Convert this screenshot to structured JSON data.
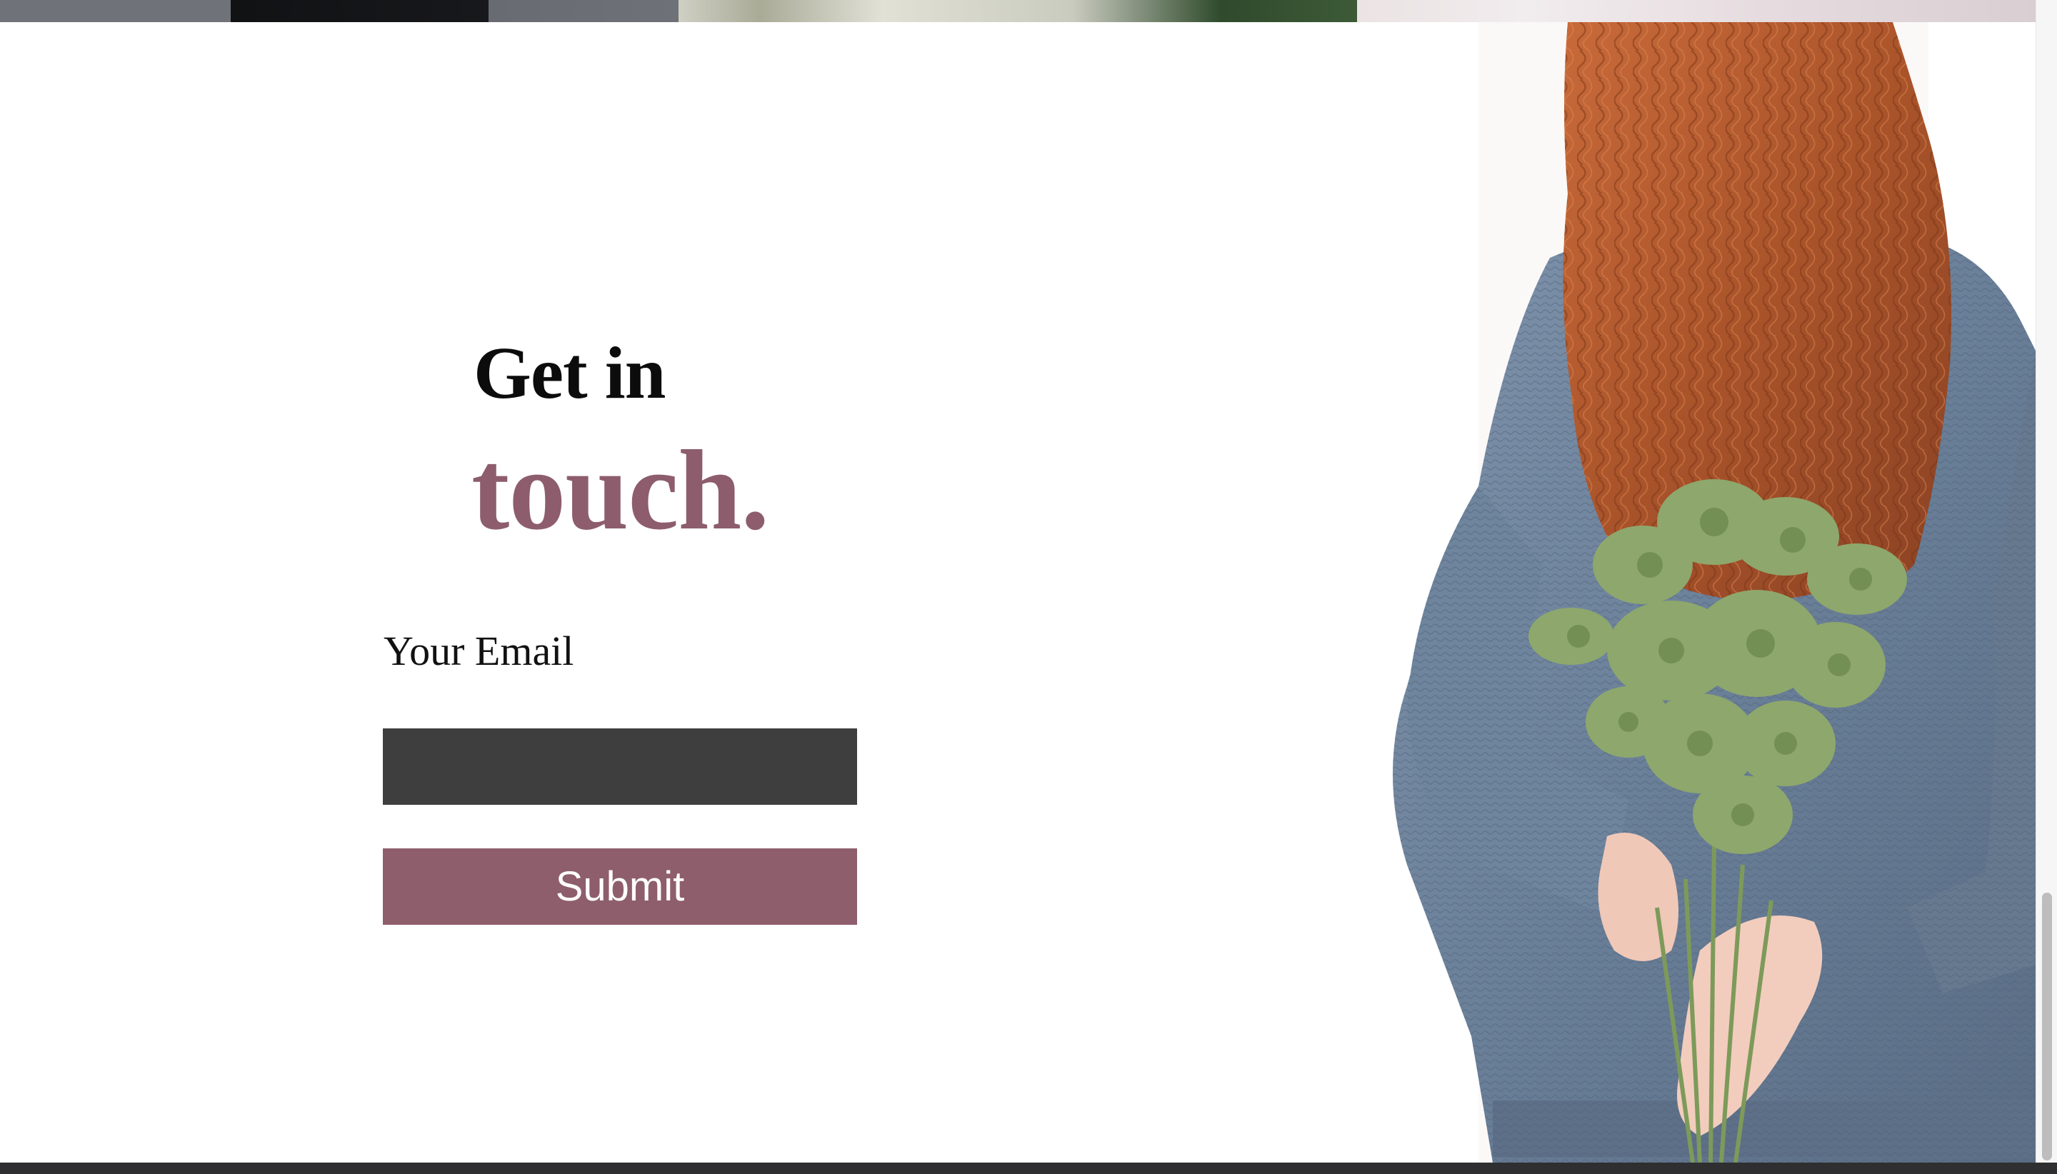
{
  "contact": {
    "heading_line1": "Get in",
    "heading_line2": "touch.",
    "email_label": "Your Email",
    "email_value": "",
    "email_placeholder": "",
    "submit_label": "Submit"
  },
  "colors": {
    "accent": "#8e5e6d",
    "input_background": "#3e3e3e",
    "heading_text": "#0c0c0c",
    "footer": "#2f2f31"
  },
  "icons": {
    "photo": "woman-with-bouquet-image"
  }
}
